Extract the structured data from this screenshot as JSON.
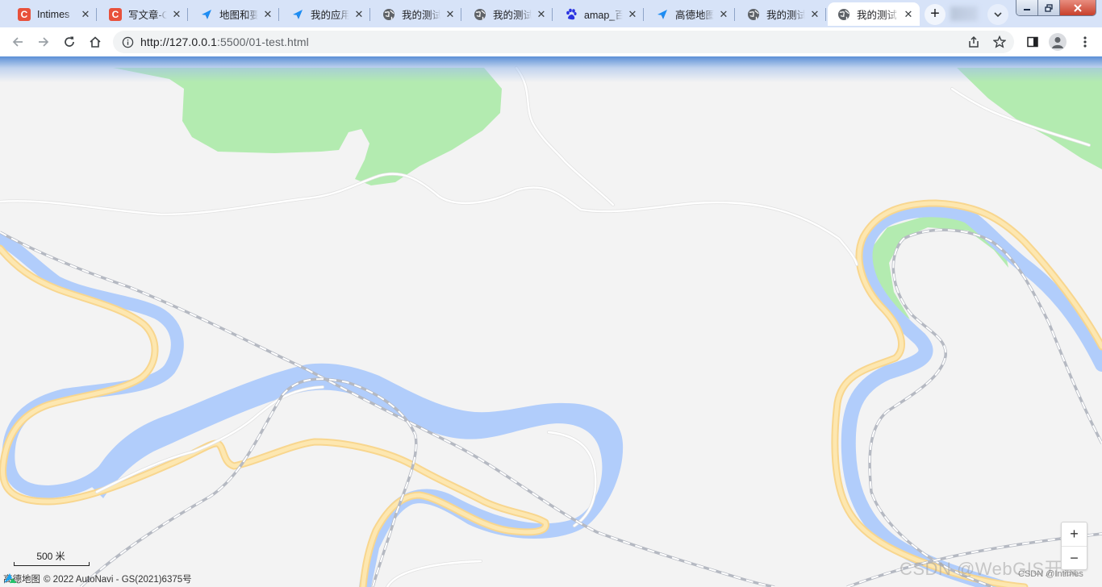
{
  "browser": {
    "tabs": [
      {
        "title": "Intimes",
        "icon": "csdn-icon",
        "active": false
      },
      {
        "title": "写文章-C",
        "icon": "csdn-icon",
        "active": false
      },
      {
        "title": "地图和要",
        "icon": "amap-icon",
        "active": false
      },
      {
        "title": "我的应用",
        "icon": "amap-icon",
        "active": false
      },
      {
        "title": "我的测试",
        "icon": "globe-icon",
        "active": false
      },
      {
        "title": "我的测试",
        "icon": "globe-icon",
        "active": false
      },
      {
        "title": "amap_百",
        "icon": "baidu-paw-icon",
        "active": false
      },
      {
        "title": "高德地图",
        "icon": "amap-icon",
        "active": false
      },
      {
        "title": "我的测试",
        "icon": "globe-icon",
        "active": false
      },
      {
        "title": "我的测试",
        "icon": "globe-icon",
        "active": true
      }
    ],
    "close_glyph": "✕",
    "new_tab_glyph": "+",
    "address": {
      "scheme_host": "http://127.0.0.1",
      "rest": ":5500/01-test.html"
    }
  },
  "map": {
    "scale_label": "500 米",
    "zoom_in": "+",
    "zoom_out": "−",
    "logo_text": "高德地图",
    "copyright": "© 2022 AutoNavi - GS(2021)6375号",
    "watermark": "CSDN @WebGIS开发",
    "watermark_small": "CSDN @Intimes",
    "colors": {
      "land": "#f3f3f3",
      "water": "#b1cdfb",
      "forest": "#b3ebb0",
      "main_road_fill": "#fde7b0",
      "main_road_casing": "#f8d68e",
      "minor_road": "#ffffff",
      "railway": "#b5b9c2"
    }
  }
}
